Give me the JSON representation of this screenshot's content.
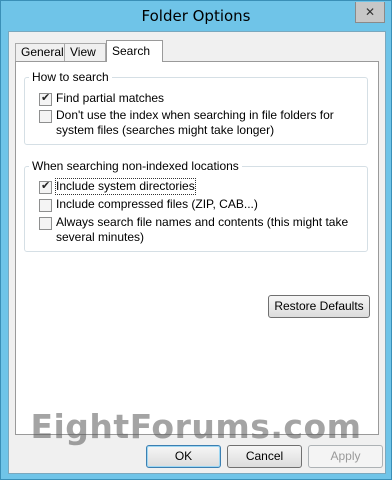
{
  "window": {
    "title": "Folder Options",
    "close_icon": "close-icon"
  },
  "tabs": [
    {
      "label": "General"
    },
    {
      "label": "View"
    },
    {
      "label": "Search",
      "active": true
    }
  ],
  "how_to_search": {
    "legend": "How to search",
    "options": [
      {
        "label": "Find partial matches",
        "checked": true
      },
      {
        "label": "Don't use the index when searching in file folders for system files (searches might take longer)",
        "checked": false
      }
    ]
  },
  "non_indexed": {
    "legend": "When searching non-indexed locations",
    "options": [
      {
        "label": "Include system directories",
        "checked": true
      },
      {
        "label": "Include compressed files (ZIP, CAB...)",
        "checked": false
      },
      {
        "label": "Always search file names and contents (this might take several minutes)",
        "checked": false
      }
    ]
  },
  "buttons": {
    "restore": "Restore Defaults",
    "ok": "OK",
    "cancel": "Cancel",
    "apply": "Apply"
  },
  "watermark": "EightForums.com"
}
